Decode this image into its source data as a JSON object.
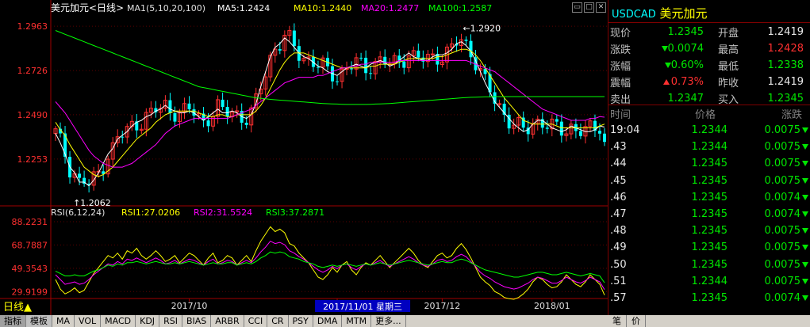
{
  "chart_header": {
    "symbol_title": "美元加元<日线>",
    "ma_params": "MA1(5,10,20,100)",
    "ma5": "MA5:1.2424",
    "ma10": "MA10:1.2440",
    "ma20": "MA20:1.2477",
    "ma100": "MA100:1.2587"
  },
  "rsi_header": {
    "params": "RSI(6,12,24)",
    "rsi1": "RSI1:27.0206",
    "rsi2": "RSI2:31.5524",
    "rsi3": "RSI3:37.2871"
  },
  "period_label": "日线▲",
  "cursor_date": "2017/11/01 星期三",
  "colors": {
    "up": "#ff3030",
    "down": "#00ffff",
    "ma5": "#ffffff",
    "ma10": "#ffff00",
    "ma20": "#ff00ff",
    "ma100": "#00ff00"
  },
  "chart_data": [
    {
      "type": "candlestick",
      "ylim": [
        1.202,
        1.301
      ],
      "y_ticks": [
        "1.2963",
        "1.2726",
        "1.2490",
        "1.2253"
      ],
      "y_tick_values": [
        1.2963,
        1.2726,
        1.249,
        1.2253
      ],
      "x_ticks": [
        "2017/10",
        "2017/1",
        "2017/12",
        "2018/01"
      ],
      "x_tick_index": [
        28,
        59,
        81,
        104
      ],
      "annotations": [
        {
          "text": "1.2920",
          "index": 85,
          "value": 1.292
        },
        {
          "text": "1.2062",
          "index": 4,
          "value": 1.2062
        }
      ],
      "series": [
        {
          "name": "MA5",
          "values": [
            1.239,
            1.234,
            1.228,
            1.221,
            1.218,
            1.213,
            1.213,
            1.211,
            1.214,
            1.218,
            1.223,
            1.228,
            1.231,
            1.236,
            1.238,
            1.24,
            1.243,
            1.245,
            1.246,
            1.248,
            1.249,
            1.251,
            1.252,
            1.254,
            1.252,
            1.251,
            1.25,
            1.25,
            1.251,
            1.25,
            1.248,
            1.246,
            1.248,
            1.25,
            1.252,
            1.25,
            1.25,
            1.251,
            1.25,
            1.248,
            1.247,
            1.249,
            1.255,
            1.264,
            1.272,
            1.28,
            1.285,
            1.287,
            1.29,
            1.288,
            1.285,
            1.282,
            1.28,
            1.279,
            1.277,
            1.275,
            1.274,
            1.272,
            1.271,
            1.27,
            1.272,
            1.274,
            1.275,
            1.276,
            1.275,
            1.274,
            1.276,
            1.277,
            1.278,
            1.277,
            1.275,
            1.276,
            1.278,
            1.28,
            1.282,
            1.28,
            1.279,
            1.278,
            1.278,
            1.28,
            1.281,
            1.281,
            1.282,
            1.284,
            1.287,
            1.288,
            1.286,
            1.283,
            1.278,
            1.272,
            1.266,
            1.261,
            1.256,
            1.253,
            1.25,
            1.247,
            1.244,
            1.242,
            1.24,
            1.241,
            1.244,
            1.246,
            1.246,
            1.244,
            1.242,
            1.241,
            1.24,
            1.241,
            1.243,
            1.242,
            1.241,
            1.24,
            1.24,
            1.241,
            1.243,
            1.2424
          ]
        },
        {
          "name": "MA10",
          "values": [
            1.245,
            1.241,
            1.238,
            1.233,
            1.229,
            1.225,
            1.221,
            1.219,
            1.217,
            1.216,
            1.217,
            1.219,
            1.221,
            1.224,
            1.227,
            1.23,
            1.233,
            1.236,
            1.238,
            1.24,
            1.242,
            1.245,
            1.247,
            1.249,
            1.25,
            1.251,
            1.251,
            1.251,
            1.251,
            1.251,
            1.25,
            1.249,
            1.248,
            1.248,
            1.249,
            1.249,
            1.248,
            1.248,
            1.249,
            1.249,
            1.249,
            1.249,
            1.251,
            1.254,
            1.258,
            1.263,
            1.268,
            1.273,
            1.277,
            1.28,
            1.282,
            1.282,
            1.282,
            1.281,
            1.28,
            1.279,
            1.278,
            1.277,
            1.276,
            1.275,
            1.274,
            1.274,
            1.274,
            1.274,
            1.274,
            1.274,
            1.275,
            1.275,
            1.276,
            1.276,
            1.276,
            1.276,
            1.277,
            1.278,
            1.279,
            1.279,
            1.279,
            1.279,
            1.279,
            1.279,
            1.28,
            1.28,
            1.281,
            1.282,
            1.283,
            1.284,
            1.284,
            1.283,
            1.281,
            1.278,
            1.274,
            1.27,
            1.266,
            1.262,
            1.258,
            1.255,
            1.252,
            1.249,
            1.246,
            1.245,
            1.244,
            1.244,
            1.244,
            1.244,
            1.244,
            1.243,
            1.242,
            1.242,
            1.242,
            1.242,
            1.242,
            1.242,
            1.242,
            1.242,
            1.243,
            1.244
          ]
        },
        {
          "name": "MA20",
          "values": [
            1.256,
            1.253,
            1.25,
            1.246,
            1.242,
            1.238,
            1.234,
            1.23,
            1.227,
            1.225,
            1.223,
            1.222,
            1.221,
            1.221,
            1.221,
            1.222,
            1.223,
            1.225,
            1.227,
            1.229,
            1.231,
            1.233,
            1.236,
            1.239,
            1.241,
            1.243,
            1.244,
            1.245,
            1.246,
            1.247,
            1.247,
            1.247,
            1.247,
            1.247,
            1.247,
            1.247,
            1.247,
            1.248,
            1.249,
            1.25,
            1.251,
            1.252,
            1.254,
            1.256,
            1.258,
            1.26,
            1.262,
            1.264,
            1.266,
            1.267,
            1.268,
            1.269,
            1.269,
            1.269,
            1.269,
            1.27,
            1.27,
            1.271,
            1.272,
            1.273,
            1.274,
            1.274,
            1.275,
            1.275,
            1.276,
            1.276,
            1.277,
            1.277,
            1.277,
            1.277,
            1.277,
            1.277,
            1.278,
            1.278,
            1.278,
            1.278,
            1.278,
            1.278,
            1.278,
            1.278,
            1.278,
            1.278,
            1.278,
            1.278,
            1.278,
            1.278,
            1.278,
            1.277,
            1.276,
            1.275,
            1.274,
            1.273,
            1.272,
            1.27,
            1.268,
            1.266,
            1.264,
            1.262,
            1.26,
            1.258,
            1.256,
            1.254,
            1.252,
            1.251,
            1.25,
            1.249,
            1.248,
            1.247,
            1.246,
            1.246,
            1.246,
            1.246,
            1.247,
            1.247,
            1.248,
            1.2477
          ]
        },
        {
          "name": "MA100",
          "values": [
            1.294,
            1.293,
            1.292,
            1.291,
            1.29,
            1.289,
            1.288,
            1.287,
            1.286,
            1.285,
            1.284,
            1.283,
            1.282,
            1.281,
            1.28,
            1.279,
            1.278,
            1.277,
            1.276,
            1.275,
            1.274,
            1.273,
            1.272,
            1.271,
            1.27,
            1.269,
            1.268,
            1.267,
            1.266,
            1.265,
            1.264,
            1.2635,
            1.263,
            1.2625,
            1.262,
            1.2615,
            1.261,
            1.2605,
            1.26,
            1.2595,
            1.259,
            1.2585,
            1.258,
            1.2578,
            1.2575,
            1.2572,
            1.257,
            1.2568,
            1.2566,
            1.2564,
            1.2562,
            1.256,
            1.2558,
            1.2556,
            1.2554,
            1.2552,
            1.255,
            1.2549,
            1.2548,
            1.2547,
            1.2546,
            1.2545,
            1.2545,
            1.2545,
            1.2545,
            1.2545,
            1.2546,
            1.2547,
            1.2548,
            1.2549,
            1.255,
            1.2552,
            1.2554,
            1.2556,
            1.2558,
            1.256,
            1.2562,
            1.2564,
            1.2566,
            1.2568,
            1.257,
            1.2572,
            1.2574,
            1.2576,
            1.2578,
            1.258,
            1.2582,
            1.2583,
            1.2584,
            1.2585,
            1.2586,
            1.2586,
            1.2587,
            1.2587,
            1.2587,
            1.2587,
            1.2587,
            1.2587,
            1.2587,
            1.2587,
            1.2587,
            1.2587,
            1.2587,
            1.2587,
            1.2587,
            1.2587,
            1.2587,
            1.2587,
            1.2587,
            1.2587,
            1.2587,
            1.2587,
            1.2587,
            1.2587,
            1.2587,
            1.2587
          ]
        }
      ]
    },
    {
      "type": "line",
      "ylim": [
        23.5,
        88.2231
      ],
      "y_ticks": [
        "88.2231",
        "68.7887",
        "49.3543",
        "29.9199"
      ],
      "y_tick_values": [
        88.2231,
        68.7887,
        49.3543,
        29.9199
      ],
      "series": [
        {
          "name": "RSI1",
          "values": [
            40,
            32,
            28,
            30,
            33,
            29,
            31,
            38,
            45,
            50,
            55,
            60,
            58,
            62,
            57,
            64,
            62,
            66,
            60,
            57,
            60,
            64,
            60,
            55,
            57,
            60,
            54,
            58,
            62,
            60,
            56,
            52,
            58,
            62,
            54,
            56,
            60,
            58,
            52,
            56,
            60,
            55,
            64,
            72,
            78,
            84,
            80,
            82,
            79,
            70,
            68,
            62,
            58,
            54,
            48,
            42,
            40,
            44,
            50,
            46,
            52,
            55,
            48,
            44,
            50,
            54,
            52,
            56,
            60,
            55,
            50,
            54,
            58,
            62,
            66,
            62,
            56,
            52,
            50,
            55,
            60,
            62,
            58,
            60,
            66,
            70,
            65,
            58,
            50,
            42,
            38,
            35,
            30,
            28,
            25,
            24,
            23.5,
            25,
            28,
            32,
            38,
            42,
            40,
            36,
            33,
            34,
            38,
            44,
            40,
            36,
            34,
            38,
            44,
            40,
            36,
            27
          ]
        },
        {
          "name": "RSI2",
          "values": [
            44,
            40,
            36,
            37,
            38,
            36,
            37,
            40,
            44,
            47,
            50,
            53,
            52,
            55,
            53,
            57,
            56,
            58,
            56,
            54,
            56,
            58,
            56,
            53,
            54,
            56,
            53,
            55,
            57,
            56,
            54,
            52,
            55,
            57,
            53,
            54,
            56,
            55,
            52,
            54,
            56,
            54,
            58,
            63,
            67,
            72,
            70,
            71,
            69,
            64,
            62,
            59,
            57,
            54,
            51,
            48,
            46,
            48,
            51,
            49,
            52,
            53,
            50,
            48,
            51,
            53,
            52,
            54,
            56,
            53,
            51,
            53,
            55,
            57,
            59,
            57,
            54,
            52,
            51,
            53,
            56,
            57,
            55,
            56,
            59,
            61,
            59,
            55,
            51,
            46,
            43,
            41,
            38,
            36,
            34,
            33,
            32,
            33,
            35,
            37,
            40,
            42,
            41,
            39,
            37,
            37,
            39,
            42,
            40,
            38,
            37,
            39,
            42,
            40,
            38,
            31.5524
          ]
        },
        {
          "name": "RSI3",
          "values": [
            47,
            45,
            43,
            43,
            44,
            43,
            43,
            45,
            47,
            48,
            50,
            52,
            51,
            53,
            52,
            54,
            54,
            55,
            54,
            53,
            54,
            55,
            54,
            53,
            53,
            54,
            53,
            54,
            55,
            54,
            53,
            52,
            53,
            54,
            53,
            53,
            54,
            54,
            52,
            53,
            54,
            53,
            55,
            58,
            60,
            63,
            62,
            63,
            62,
            59,
            58,
            57,
            55,
            54,
            53,
            51,
            50,
            51,
            52,
            51,
            52,
            53,
            52,
            51,
            52,
            53,
            52,
            53,
            54,
            53,
            52,
            53,
            54,
            55,
            56,
            55,
            54,
            53,
            52,
            53,
            54,
            55,
            54,
            54,
            56,
            57,
            56,
            54,
            52,
            50,
            48,
            47,
            46,
            45,
            44,
            43,
            42,
            42,
            43,
            44,
            45,
            46,
            46,
            45,
            44,
            44,
            45,
            46,
            45,
            44,
            43,
            44,
            45,
            44,
            43,
            37.2871
          ]
        }
      ]
    }
  ],
  "right_panel": {
    "code": "USDCAD",
    "name": "美元加元",
    "quote": [
      {
        "l1": "现价",
        "v1": "1.2345",
        "c1": "g",
        "l2": "开盘",
        "v2": "1.2419",
        "c2": "w"
      },
      {
        "l1": "涨跌",
        "v1": "0.0074",
        "c1": "g",
        "a1": "down",
        "l2": "最高",
        "v2": "1.2428",
        "c2": "r"
      },
      {
        "l1": "涨幅",
        "v1": "0.60%",
        "c1": "g",
        "a1": "down",
        "l2": "最低",
        "v2": "1.2338",
        "c2": "g"
      },
      {
        "l1": "震幅",
        "v1": "0.73%",
        "c1": "r",
        "a1": "up",
        "l2": "昨收",
        "v2": "1.2419",
        "c2": "w"
      },
      {
        "l1": "卖出",
        "v1": "1.2347",
        "c1": "g",
        "l2": "买入",
        "v2": "1.2345",
        "c2": "g"
      }
    ],
    "tick_headers": [
      "时间",
      "价格",
      "涨跌"
    ],
    "ticks": [
      {
        "time": "19:04",
        "price": "1.2344",
        "change": "0.0075"
      },
      {
        "time": ".43",
        "price": "1.2344",
        "change": "0.0075"
      },
      {
        "time": ".44",
        "price": "1.2345",
        "change": "0.0075"
      },
      {
        "time": ".45",
        "price": "1.2345",
        "change": "0.0075"
      },
      {
        "time": ".46",
        "price": "1.2345",
        "change": "0.0074"
      },
      {
        "time": ".47",
        "price": "1.2345",
        "change": "0.0074"
      },
      {
        "time": ".48",
        "price": "1.2345",
        "change": "0.0075"
      },
      {
        "time": ".49",
        "price": "1.2345",
        "change": "0.0075"
      },
      {
        "time": ".50",
        "price": "1.2345",
        "change": "0.0075"
      },
      {
        "time": ".51",
        "price": "1.2344",
        "change": "0.0075"
      },
      {
        "time": ".57",
        "price": "1.2345",
        "change": "0.0074"
      }
    ],
    "bottom_tabs": [
      "笔",
      "价"
    ]
  },
  "bottom_tabs": [
    "指标",
    "模板",
    "MA",
    "VOL",
    "MACD",
    "KDJ",
    "RSI",
    "BIAS",
    "ARBR",
    "CCI",
    "CR",
    "PSY",
    "DMA",
    "MTM",
    "更多..."
  ]
}
